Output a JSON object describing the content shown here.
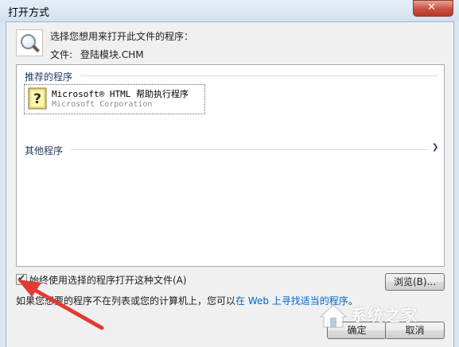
{
  "window": {
    "title": "打开方式"
  },
  "header": {
    "prompt": "选择您想用来打开此文件的程序：",
    "file_label": "文件:",
    "file_name": "登陆模块.CHM"
  },
  "list": {
    "recommended_label": "推荐的程序",
    "other_label": "其他程序",
    "programs": [
      {
        "name": "Microsoft® HTML 帮助执行程序",
        "company": "Microsoft Corporation",
        "icon": "help-icon"
      }
    ]
  },
  "options": {
    "always_use_label": "始终使用选择的程序打开这种文件(A)",
    "always_use_checked": true
  },
  "buttons": {
    "browse": "浏览(B)...",
    "ok": "确定",
    "cancel": "取消"
  },
  "note": {
    "prefix": "如果您想要的程序不在列表或您的计算机上，您可以",
    "link": "在 Web 上寻找适当的程序",
    "suffix": "。"
  },
  "watermark": {
    "text": "系统之家"
  },
  "colors": {
    "accent": "#1e395b",
    "link": "#0066cc",
    "arrow": "#e23b32",
    "close": "#c8503d"
  }
}
